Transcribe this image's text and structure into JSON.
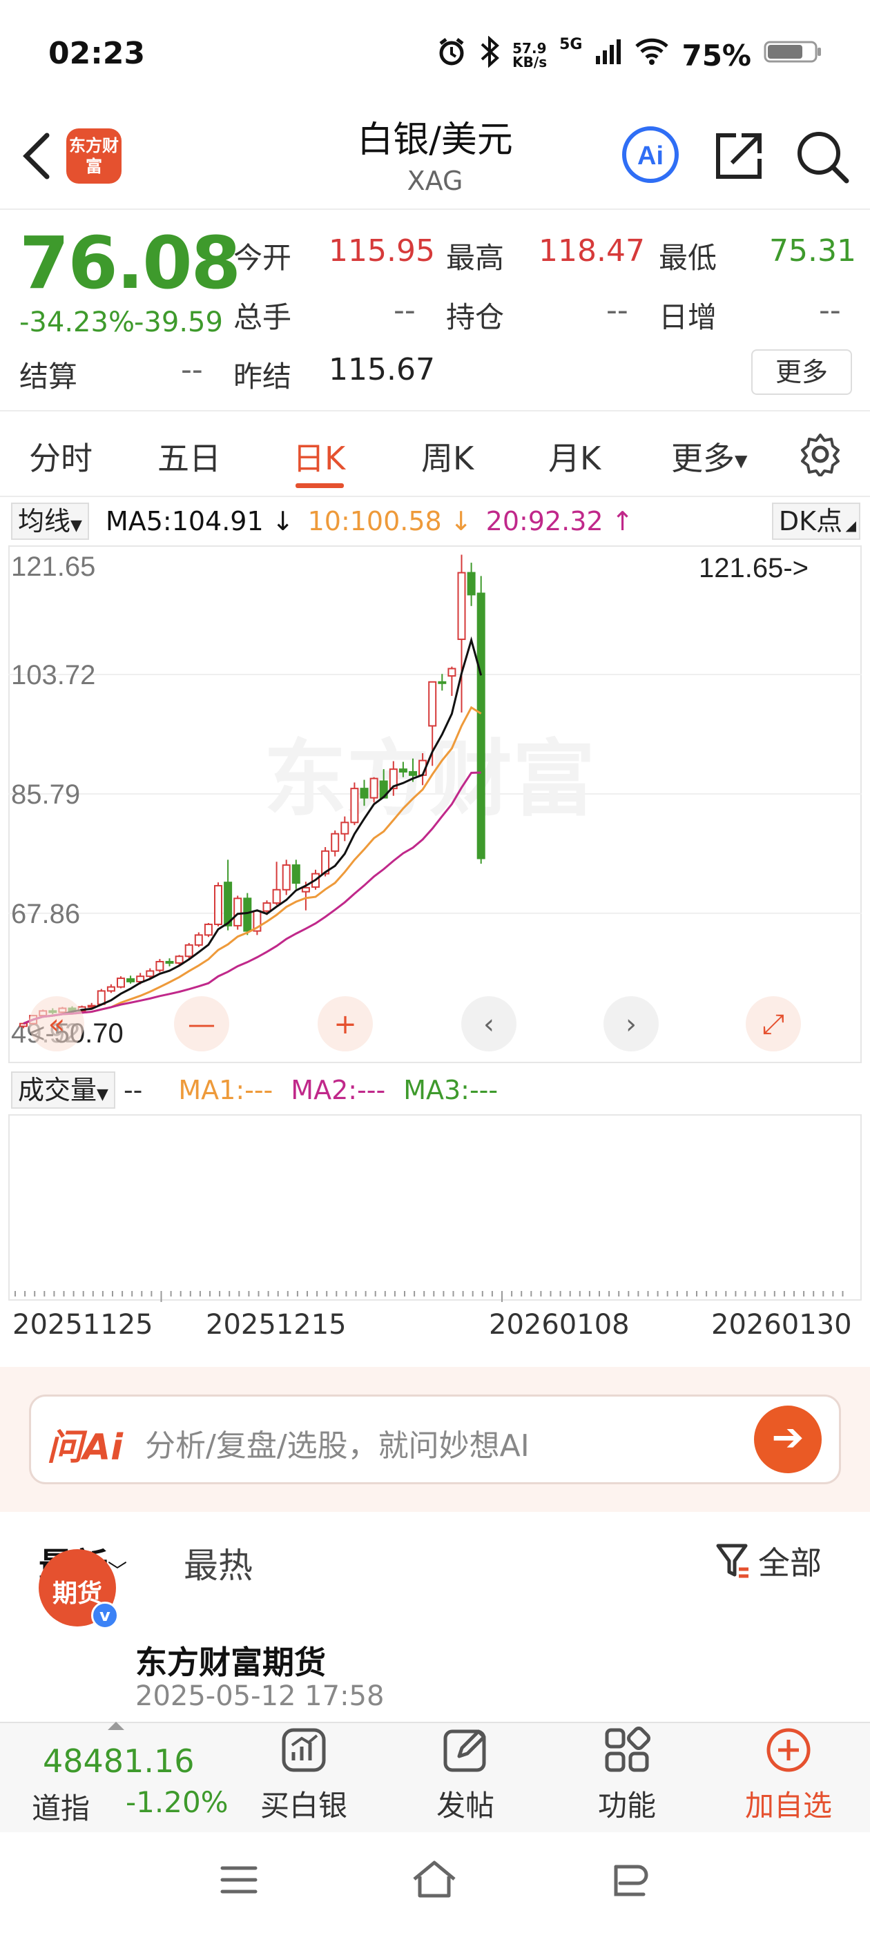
{
  "status_bar": {
    "time": "02:23",
    "net_speed_top": "57.9",
    "net_speed_unit": "KB/s",
    "signal": "5G",
    "battery": "75%"
  },
  "header": {
    "logo_text": "东方财富",
    "title": "白银/美元",
    "symbol": "XAG"
  },
  "quote": {
    "price": "76.08",
    "change_pct": "-34.23%",
    "change": "-39.59",
    "open_label": "今开",
    "open": "115.95",
    "high_label": "最高",
    "high": "118.47",
    "low_label": "最低",
    "low": "75.31",
    "volume_label": "总手",
    "volume": "--",
    "position_label": "持仓",
    "position": "--",
    "daily_inc_label": "日增",
    "daily_inc": "--",
    "settle_label": "结算",
    "settle": "--",
    "prev_settle_label": "昨结",
    "prev_settle": "115.67",
    "more": "更多"
  },
  "tabs": [
    "分时",
    "五日",
    "日K",
    "周K",
    "月K",
    "更多"
  ],
  "active_tab": "日K",
  "indicator": {
    "select": "均线",
    "ma5": "MA5:104.91",
    "ma10": "10:100.58",
    "ma20": "20:92.32",
    "dk": "DK点"
  },
  "colors": {
    "up": "#d63a3a",
    "down": "#3e9a2c",
    "ma5": "#111111",
    "ma10": "#ee9a3a",
    "ma20": "#c0288a",
    "accent": "#e5512f"
  },
  "chart_data": {
    "type": "candlestick",
    "y_ticks": [
      "121.65",
      "103.72",
      "85.79",
      "67.86",
      "49.92"
    ],
    "ylim": [
      49.92,
      121.65
    ],
    "x_tick_labels": [
      "20251125",
      "20251215",
      "20260108",
      "20260130"
    ],
    "annotations": {
      "max_label": "121.65->",
      "min_label": "50.70"
    },
    "watermark": "东方财富",
    "candles": [
      [
        50.9,
        51.4,
        50.6,
        51.3
      ],
      [
        51.3,
        52.6,
        51.1,
        52.5
      ],
      [
        52.5,
        53.4,
        52.3,
        53.2
      ],
      [
        53.2,
        53.6,
        52.7,
        53.0
      ],
      [
        53.0,
        53.8,
        52.8,
        53.6
      ],
      [
        53.6,
        53.9,
        53.0,
        53.2
      ],
      [
        53.2,
        54.0,
        52.9,
        53.8
      ],
      [
        53.8,
        54.4,
        53.4,
        54.0
      ],
      [
        54.2,
        56.5,
        54.0,
        56.2
      ],
      [
        56.2,
        57.2,
        55.9,
        56.8
      ],
      [
        56.8,
        58.4,
        56.6,
        58.1
      ],
      [
        58.0,
        58.5,
        57.3,
        57.6
      ],
      [
        57.6,
        58.9,
        57.2,
        58.4
      ],
      [
        58.4,
        59.6,
        57.9,
        59.2
      ],
      [
        59.3,
        61.0,
        59.0,
        60.6
      ],
      [
        60.6,
        61.1,
        59.9,
        60.4
      ],
      [
        60.4,
        61.6,
        59.9,
        61.4
      ],
      [
        61.4,
        63.4,
        61.1,
        63.1
      ],
      [
        63.1,
        65.0,
        62.8,
        64.6
      ],
      [
        64.6,
        66.4,
        64.3,
        66.2
      ],
      [
        66.2,
        72.5,
        65.9,
        72.0
      ],
      [
        72.5,
        75.9,
        65.3,
        66.0
      ],
      [
        66.0,
        70.5,
        65.4,
        70.1
      ],
      [
        70.1,
        70.9,
        64.6,
        65.2
      ],
      [
        65.2,
        68.4,
        64.6,
        68.2
      ],
      [
        68.2,
        69.8,
        67.6,
        69.4
      ],
      [
        69.4,
        75.6,
        69.1,
        71.4
      ],
      [
        71.4,
        75.9,
        70.6,
        75.1
      ],
      [
        75.1,
        75.9,
        71.5,
        72.4
      ],
      [
        71.1,
        72.6,
        68.3,
        71.7
      ],
      [
        71.8,
        74.4,
        71.4,
        73.8
      ],
      [
        73.8,
        77.8,
        73.4,
        77.2
      ],
      [
        77.2,
        80.3,
        76.4,
        79.8
      ],
      [
        79.8,
        82.4,
        78.7,
        81.5
      ],
      [
        81.5,
        87.5,
        81.1,
        86.6
      ],
      [
        86.6,
        87.9,
        84.0,
        85.2
      ],
      [
        85.2,
        88.3,
        84.5,
        88.1
      ],
      [
        87.7,
        89.5,
        86.7,
        85.2
      ],
      [
        86.6,
        90.7,
        85.5,
        89.5
      ],
      [
        89.5,
        90.6,
        88.3,
        89.1
      ],
      [
        89.1,
        91.1,
        87.6,
        88.6
      ],
      [
        88.6,
        91.9,
        87.1,
        90.8
      ],
      [
        96.0,
        99.1,
        90.0,
        102.6
      ],
      [
        102.6,
        103.8,
        101.3,
        102.5
      ],
      [
        103.5,
        104.9,
        100.5,
        104.6
      ],
      [
        109.0,
        121.7,
        98.0,
        119.0
      ],
      [
        119.0,
        120.5,
        114.0,
        115.7
      ],
      [
        115.9,
        118.5,
        75.3,
        76.1
      ]
    ],
    "ma5_last": 104.91,
    "ma10_last": 100.58,
    "ma20_last": 92.32
  },
  "volume_panel": {
    "select": "成交量",
    "value": "--",
    "ma1": "MA1:---",
    "ma2": "MA2:---",
    "ma3": "MA3:---"
  },
  "ask_ai": {
    "logo": "问Ai",
    "placeholder": "分析/复盘/选股，就问妙想AI"
  },
  "feed": {
    "tab_latest": "最新",
    "tab_hot": "最热",
    "filter": "全部",
    "post_author": "东方财富期货",
    "post_avatar_text": "期货",
    "post_time": "2025-05-12 17:58"
  },
  "bottom_bar": {
    "index_value": "48481.16",
    "index_name": "道指",
    "index_change": "-1.20%",
    "buy": "买白银",
    "post": "发帖",
    "func": "功能",
    "add": "加自选"
  }
}
